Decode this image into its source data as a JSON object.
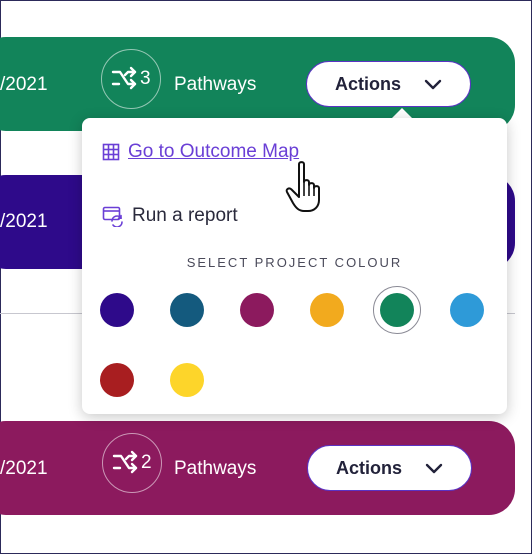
{
  "cards": [
    {
      "date": "/2021",
      "pathways_count": "3",
      "pathways_label": "Pathways",
      "actions_label": "Actions",
      "color": "#12845a"
    },
    {
      "date": "/2021",
      "color": "#2e0a8a"
    },
    {
      "date": "/2021",
      "pathways_count": "2",
      "pathways_label": "Pathways",
      "actions_label": "Actions",
      "color": "#8c1a5e"
    }
  ],
  "dropdown": {
    "outcome_map_label": "Go to Outcome Map",
    "report_label": "Run a report",
    "colour_heading": "SELECT PROJECT COLOUR",
    "colours": [
      "#2e0a8a",
      "#145a7e",
      "#8c1a5e",
      "#f2aa1e",
      "#12845a",
      "#2e9ad8",
      "#a81e20",
      "#fdd52a"
    ],
    "selected_colour": "#12845a"
  },
  "icons": {
    "pathways": "shuffle-icon",
    "chevron": "chevron-down-icon",
    "map": "grid-icon",
    "report": "report-refresh-icon",
    "cursor": "hand-pointer-icon"
  }
}
